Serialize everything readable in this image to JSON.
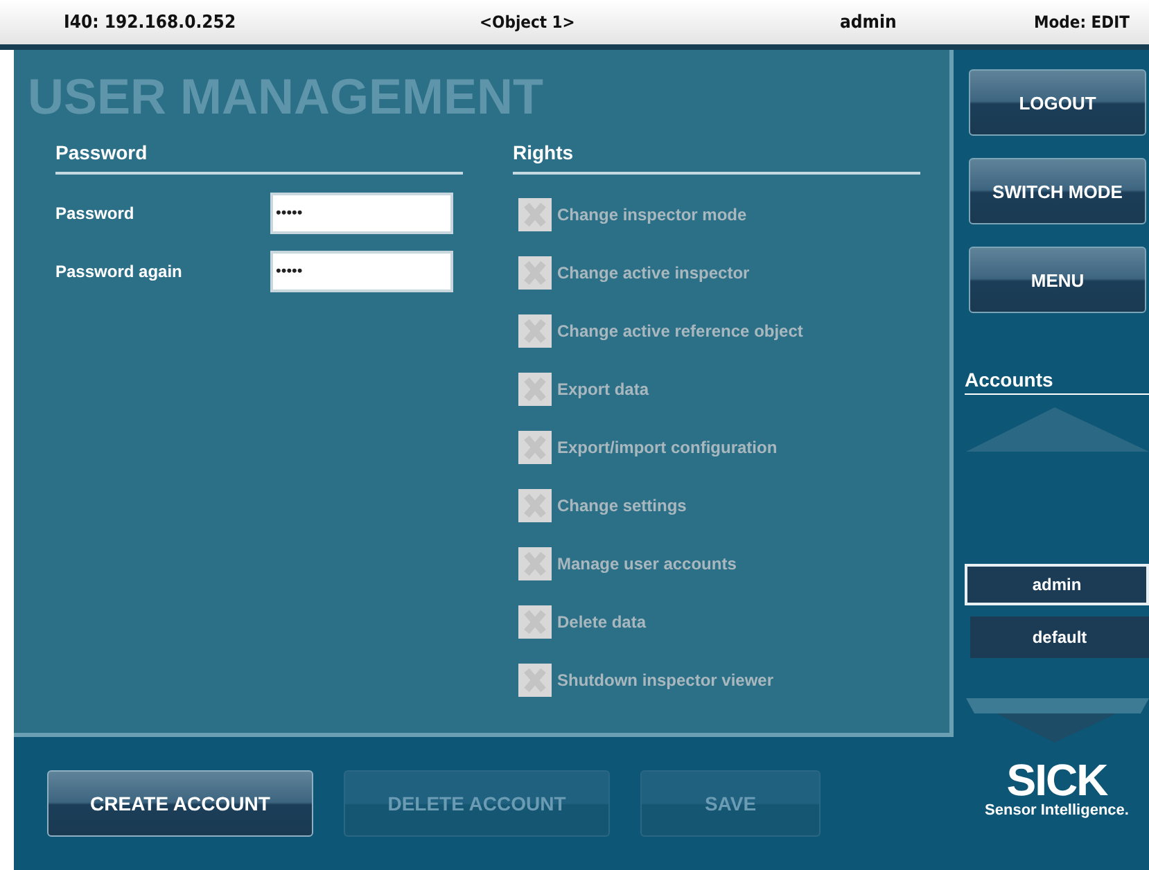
{
  "status_bar": {
    "device": "I40: 192.168.0.252",
    "object": "<Object 1>",
    "user": "admin",
    "mode": "Mode: EDIT"
  },
  "title": "USER MANAGEMENT",
  "password": {
    "heading": "Password",
    "fields": [
      {
        "label": "Password",
        "value": "•••••"
      },
      {
        "label": "Password again",
        "value": "•••••"
      }
    ]
  },
  "rights": {
    "heading": "Rights",
    "items": [
      {
        "label": "Change inspector mode",
        "disabled": true
      },
      {
        "label": "Change active inspector",
        "disabled": true
      },
      {
        "label": "Change active reference object",
        "disabled": true
      },
      {
        "label": "Export data",
        "disabled": true
      },
      {
        "label": "Export/import configuration",
        "disabled": true
      },
      {
        "label": "Change settings",
        "disabled": true
      },
      {
        "label": "Manage user accounts",
        "disabled": true
      },
      {
        "label": "Delete data",
        "disabled": true
      },
      {
        "label": "Shutdown inspector viewer",
        "disabled": true
      }
    ]
  },
  "side_buttons": [
    "LOGOUT",
    "SWITCH MODE",
    "MENU"
  ],
  "accounts": {
    "heading": "Accounts",
    "items": [
      {
        "label": "admin",
        "selected": true
      },
      {
        "label": "default",
        "selected": false
      }
    ]
  },
  "bottom_buttons": [
    {
      "label": "CREATE ACCOUNT",
      "disabled": false
    },
    {
      "label": "DELETE ACCOUNT",
      "disabled": true
    },
    {
      "label": "SAVE",
      "disabled": true
    }
  ],
  "logo": {
    "brand": "SICK",
    "tagline": "Sensor Intelligence."
  }
}
